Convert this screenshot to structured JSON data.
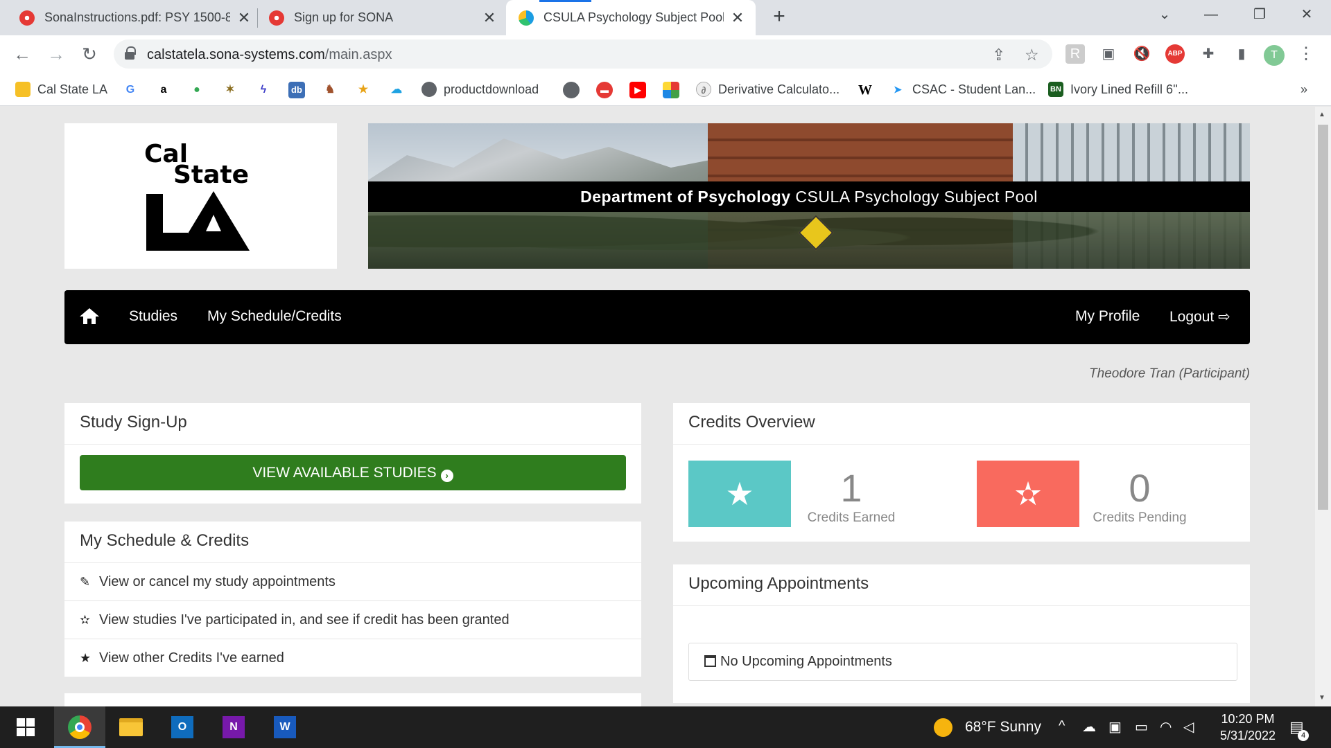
{
  "browser": {
    "tabs": [
      {
        "title": "SonaInstructions.pdf: PSY 1500-8",
        "favicon": "sona-icon"
      },
      {
        "title": "Sign up for SONA",
        "favicon": "sona-icon"
      },
      {
        "title": "CSULA Psychology Subject Pool",
        "favicon": "edge-icon",
        "active": true
      }
    ],
    "url_host": "calstatela.sona-systems.com",
    "url_path": "/main.aspx",
    "profile_initial": "T",
    "abp_label": "ABP",
    "bookmarks": [
      {
        "label": "Cal State LA"
      },
      {
        "label": "productdownload"
      },
      {
        "label": "Derivative Calculato..."
      },
      {
        "label": "CSAC - Student Lan..."
      },
      {
        "label": "Ivory Lined Refill 6''..."
      }
    ],
    "more_bookmarks": "»"
  },
  "site": {
    "logo": {
      "line1": "Cal",
      "line2": "State"
    },
    "banner": {
      "dept": "Department of Psychology",
      "pool": "CSULA Psychology Subject Pool"
    },
    "nav": {
      "studies": "Studies",
      "schedule": "My Schedule/Credits",
      "profile": "My Profile",
      "logout": "Logout"
    },
    "user": "Theodore Tran (Participant)"
  },
  "signup": {
    "title": "Study Sign-Up",
    "button": "VIEW AVAILABLE STUDIES"
  },
  "schedule": {
    "title": "My Schedule & Credits",
    "items": [
      {
        "label": "View or cancel my study appointments",
        "icon": "edit-icon"
      },
      {
        "label": "View studies I've participated in, and see if credit has been granted",
        "icon": "half-star-icon"
      },
      {
        "label": "View other Credits I've earned",
        "icon": "star-icon"
      }
    ]
  },
  "credits": {
    "title": "Credits Overview",
    "earned": {
      "value": "1",
      "label": "Credits Earned",
      "color": "#5bc8c6"
    },
    "pending": {
      "value": "0",
      "label": "Credits Pending",
      "color": "#f96a5e"
    }
  },
  "appointments": {
    "title": "Upcoming Appointments",
    "empty": "No Upcoming Appointments"
  },
  "taskbar": {
    "weather": "68°F  Sunny",
    "time": "10:20 PM",
    "date": "5/31/2022",
    "notifications": "4"
  }
}
